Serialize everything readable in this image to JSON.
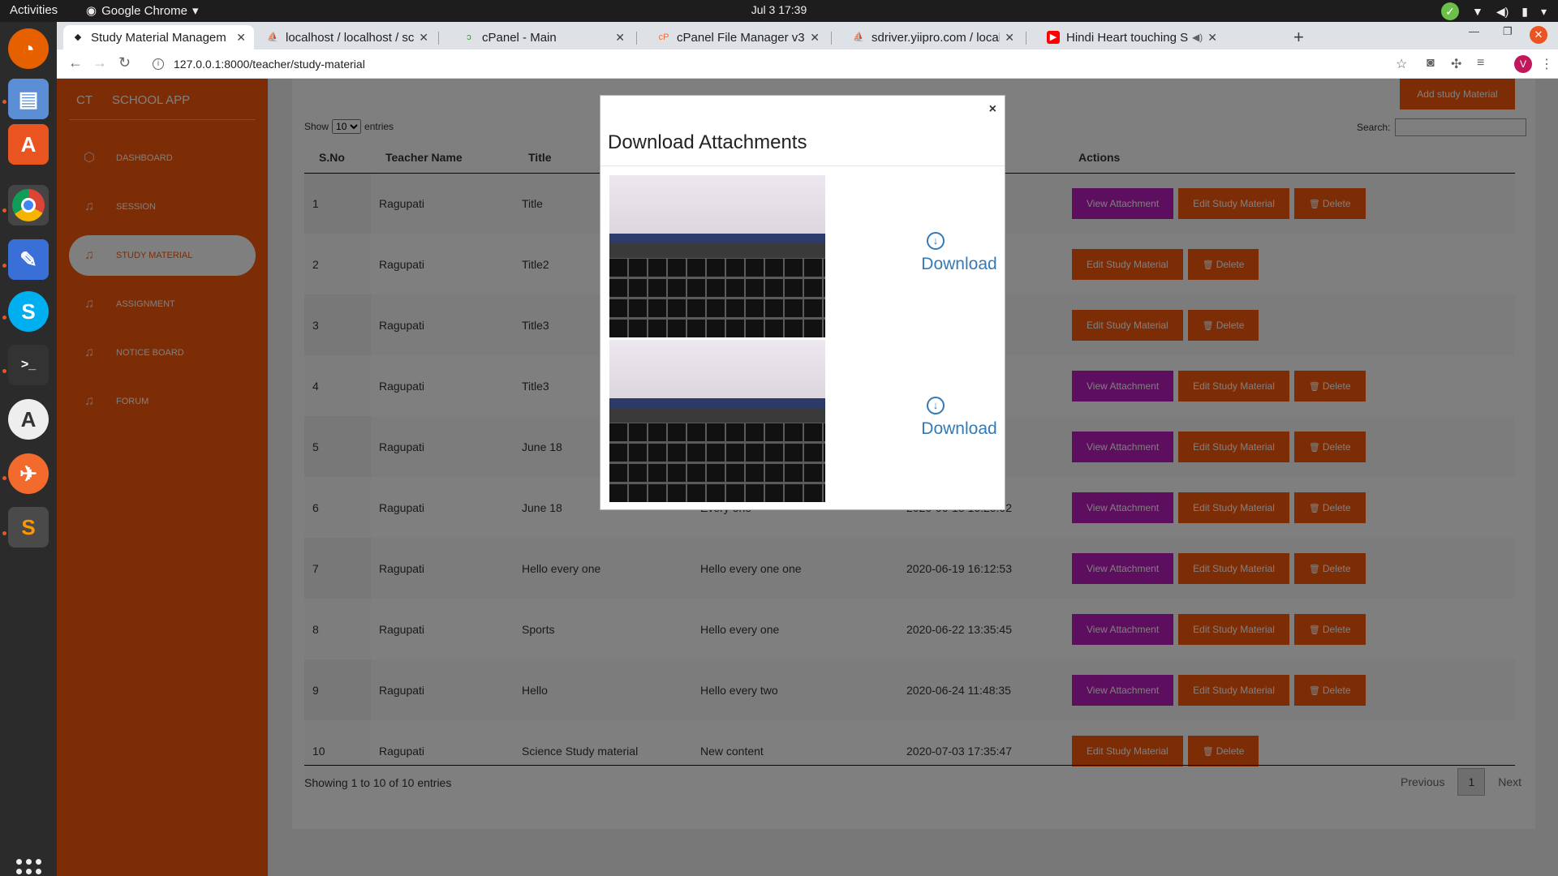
{
  "topbar": {
    "activities": "Activities",
    "app_name": "Google Chrome",
    "clock": "Jul 3  17:39"
  },
  "browser": {
    "tabs": [
      {
        "title": "Study Material Managem",
        "icon_color": "#202124"
      },
      {
        "title": "localhost / localhost / sch",
        "icon_color": "#f29111"
      },
      {
        "title": "cPanel - Main",
        "icon_color": "#2a9d2a"
      },
      {
        "title": "cPanel File Manager v3",
        "icon_color": "#ff6c2c"
      },
      {
        "title": "sdriver.yiipro.com / localh",
        "icon_color": "#f29111"
      },
      {
        "title": "Hindi Heart touching S",
        "icon_color": "#ff0000"
      }
    ],
    "url": "127.0.0.1:8000/teacher/study-material",
    "profile_initial": "V"
  },
  "sidebar": {
    "brand_short": "CT",
    "brand_name": "SCHOOL APP",
    "items": [
      {
        "label": "DASHBOARD",
        "icon": "cube-icon"
      },
      {
        "label": "SESSION",
        "icon": "bell-icon"
      },
      {
        "label": "STUDY MATERIAL",
        "icon": "bell-icon"
      },
      {
        "label": "ASSIGNMENT",
        "icon": "bell-icon"
      },
      {
        "label": "NOTICE BOARD",
        "icon": "bell-icon"
      },
      {
        "label": "FORUM",
        "icon": "bell-icon"
      }
    ],
    "accent_color": "#fb5a0d"
  },
  "main": {
    "add_button": "Add study Material",
    "show_label": "Show",
    "entries_value": "10",
    "entries_label": "entries",
    "search_label": "Search:",
    "columns": [
      "S.No",
      "Teacher Name",
      "Title",
      "",
      "",
      "Actions"
    ],
    "rows": [
      {
        "sno": "1",
        "teacher": "Ragupati",
        "title": "Title",
        "desc": "",
        "date": ":00",
        "view": true
      },
      {
        "sno": "2",
        "teacher": "Ragupati",
        "title": "Title2",
        "desc": "",
        "date": ":00",
        "view": false
      },
      {
        "sno": "3",
        "teacher": "Ragupati",
        "title": "Title3",
        "desc": "",
        "date": ":00",
        "view": false
      },
      {
        "sno": "4",
        "teacher": "Ragupati",
        "title": "Title3",
        "desc": "",
        "date": ":49",
        "view": true
      },
      {
        "sno": "5",
        "teacher": "Ragupati",
        "title": "June 18",
        "desc": "",
        "date": ":03",
        "view": true
      },
      {
        "sno": "6",
        "teacher": "Ragupati",
        "title": "June 18",
        "desc": "Every one",
        "date": "2020-06-18 16:25:02",
        "view": true
      },
      {
        "sno": "7",
        "teacher": "Ragupati",
        "title": "Hello every one",
        "desc": "Hello every one one",
        "date": "2020-06-19 16:12:53",
        "view": true
      },
      {
        "sno": "8",
        "teacher": "Ragupati",
        "title": "Sports",
        "desc": "Hello every one",
        "date": "2020-06-22 13:35:45",
        "view": true
      },
      {
        "sno": "9",
        "teacher": "Ragupati",
        "title": "Hello",
        "desc": "Hello every two",
        "date": "2020-06-24 11:48:35",
        "view": true
      },
      {
        "sno": "10",
        "teacher": "Ragupati",
        "title": "Science Study material",
        "desc": "New content",
        "date": "2020-07-03 17:35:47",
        "view": false
      }
    ],
    "action_labels": {
      "view": "View Attachment",
      "edit": "Edit Study Material",
      "delete": "Delete"
    },
    "info": "Showing 1 to 10 of 10 entries",
    "pager": {
      "previous": "Previous",
      "current": "1",
      "next": "Next"
    }
  },
  "modal": {
    "close": "×",
    "title": "Download Attachments",
    "attachments": [
      {
        "link_label": "Download"
      },
      {
        "link_label": "Download"
      }
    ]
  }
}
